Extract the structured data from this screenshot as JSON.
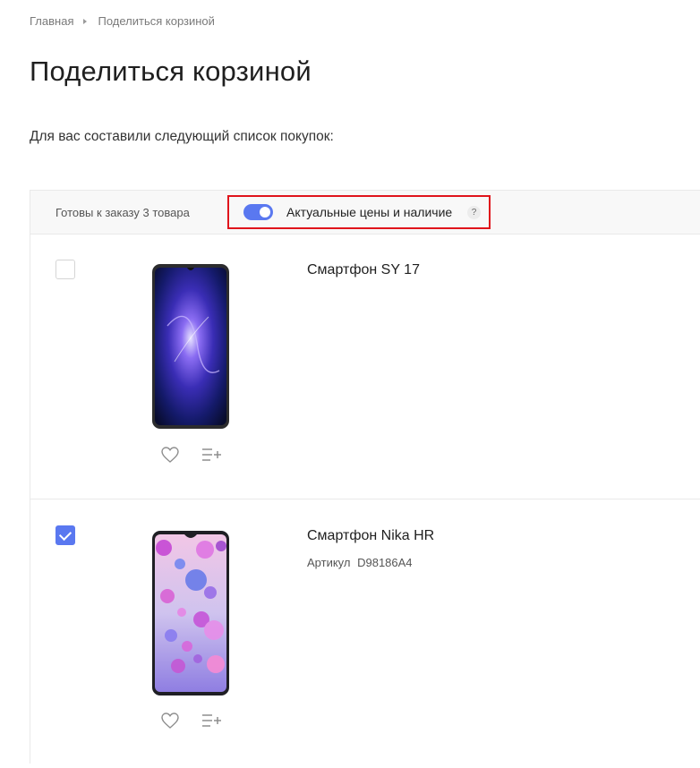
{
  "breadcrumb": {
    "home": "Главная",
    "current": "Поделиться корзиной"
  },
  "page": {
    "title": "Поделиться корзиной",
    "intro": "Для вас составили следующий список покупок:"
  },
  "cart": {
    "ready_label": "Готовы к заказу 3 товара",
    "toggle_label": "Актуальные цены и наличие",
    "toggle_on": true,
    "help_glyph": "?",
    "items": [
      {
        "name": "Смартфон SY 17",
        "checked": false
      },
      {
        "name": "Смартфон Nika HR",
        "article_label": "Артикул",
        "article_value": "D98186A4",
        "checked": true
      }
    ]
  },
  "colors": {
    "accent": "#5a78f0",
    "highlight": "#e0141b",
    "header_bg": "#f8f8f8",
    "border": "#e9e9e9"
  },
  "icons": {
    "favorite": "heart-icon",
    "add_to_list": "add-to-list-icon",
    "check": "checkmark-icon",
    "breadcrumb_separator": "triangle-right-icon"
  }
}
